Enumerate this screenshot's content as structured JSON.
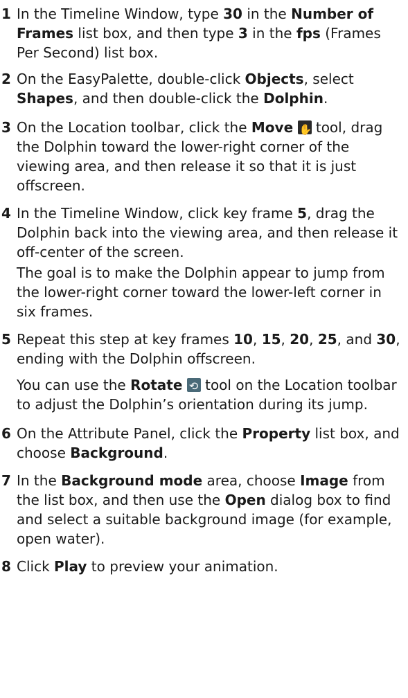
{
  "steps": [
    {
      "num": "1",
      "parts": [
        {
          "t": "In the Timeline Window, type "
        },
        {
          "t": "30",
          "b": true
        },
        {
          "t": " in the "
        },
        {
          "t": "Number of Frames",
          "b": true
        },
        {
          "t": " list box, and then type "
        },
        {
          "t": "3",
          "b": true
        },
        {
          "t": " in the "
        },
        {
          "t": "fps",
          "b": true
        },
        {
          "t": " (Frames Per Second) list box."
        }
      ]
    },
    {
      "num": "2",
      "parts": [
        {
          "t": "On the EasyPalette, double-click "
        },
        {
          "t": "Objects",
          "b": true
        },
        {
          "t": ", select "
        },
        {
          "t": "Shapes",
          "b": true
        },
        {
          "t": ", and then double-click the "
        },
        {
          "t": "Dolphin",
          "b": true
        },
        {
          "t": "."
        }
      ]
    },
    {
      "num": "3",
      "parts": [
        {
          "t": "On the Location toolbar, click the "
        },
        {
          "t": "Move",
          "b": true
        },
        {
          "icon": "move-icon"
        },
        {
          "t": " tool, drag the Dolphin toward the lower-right corner of the viewing area, and then release it so that it is just offscreen."
        }
      ]
    },
    {
      "num": "4",
      "parts": [
        {
          "t": "In the Timeline Window, click key frame "
        },
        {
          "t": "5",
          "b": true
        },
        {
          "t": ", drag the Dolphin back into the viewing area, and then release it off-center of the screen."
        }
      ],
      "note": [
        {
          "t": "The goal is to make the Dolphin appear to jump from the lower-right corner toward the lower-left corner in six frames."
        }
      ]
    },
    {
      "num": "5",
      "parts": [
        {
          "t": "Repeat this step at key frames "
        },
        {
          "t": "10",
          "b": true
        },
        {
          "t": ", "
        },
        {
          "t": "15",
          "b": true
        },
        {
          "t": ", "
        },
        {
          "t": "20",
          "b": true
        },
        {
          "t": ", "
        },
        {
          "t": "25",
          "b": true
        },
        {
          "t": ", and "
        },
        {
          "t": "30",
          "b": true
        },
        {
          "t": ", ending with the Dolphin offscreen."
        }
      ],
      "note": [
        {
          "t": "You can use the "
        },
        {
          "t": "Rotate",
          "b": true
        },
        {
          "icon": "rotate-icon"
        },
        {
          "t": " tool on the Location toolbar to adjust the Dolphin’s orientation during its jump."
        }
      ]
    },
    {
      "num": "6",
      "parts": [
        {
          "t": "On the Attribute Panel, click the "
        },
        {
          "t": "Property",
          "b": true
        },
        {
          "t": " list box, and choose "
        },
        {
          "t": "Background",
          "b": true
        },
        {
          "t": "."
        }
      ]
    },
    {
      "num": "7",
      "parts": [
        {
          "t": "In the "
        },
        {
          "t": "Background mode",
          "b": true
        },
        {
          "t": " area, choose "
        },
        {
          "t": "Image",
          "b": true
        },
        {
          "t": " from the list box, and then use the "
        },
        {
          "t": "Open",
          "b": true
        },
        {
          "t": " dialog box to find and select a suitable background image (for example, open water)."
        }
      ]
    },
    {
      "num": "8",
      "parts": [
        {
          "t": "Click "
        },
        {
          "t": "Play",
          "b": true
        },
        {
          "t": " to preview your animation."
        }
      ]
    }
  ]
}
